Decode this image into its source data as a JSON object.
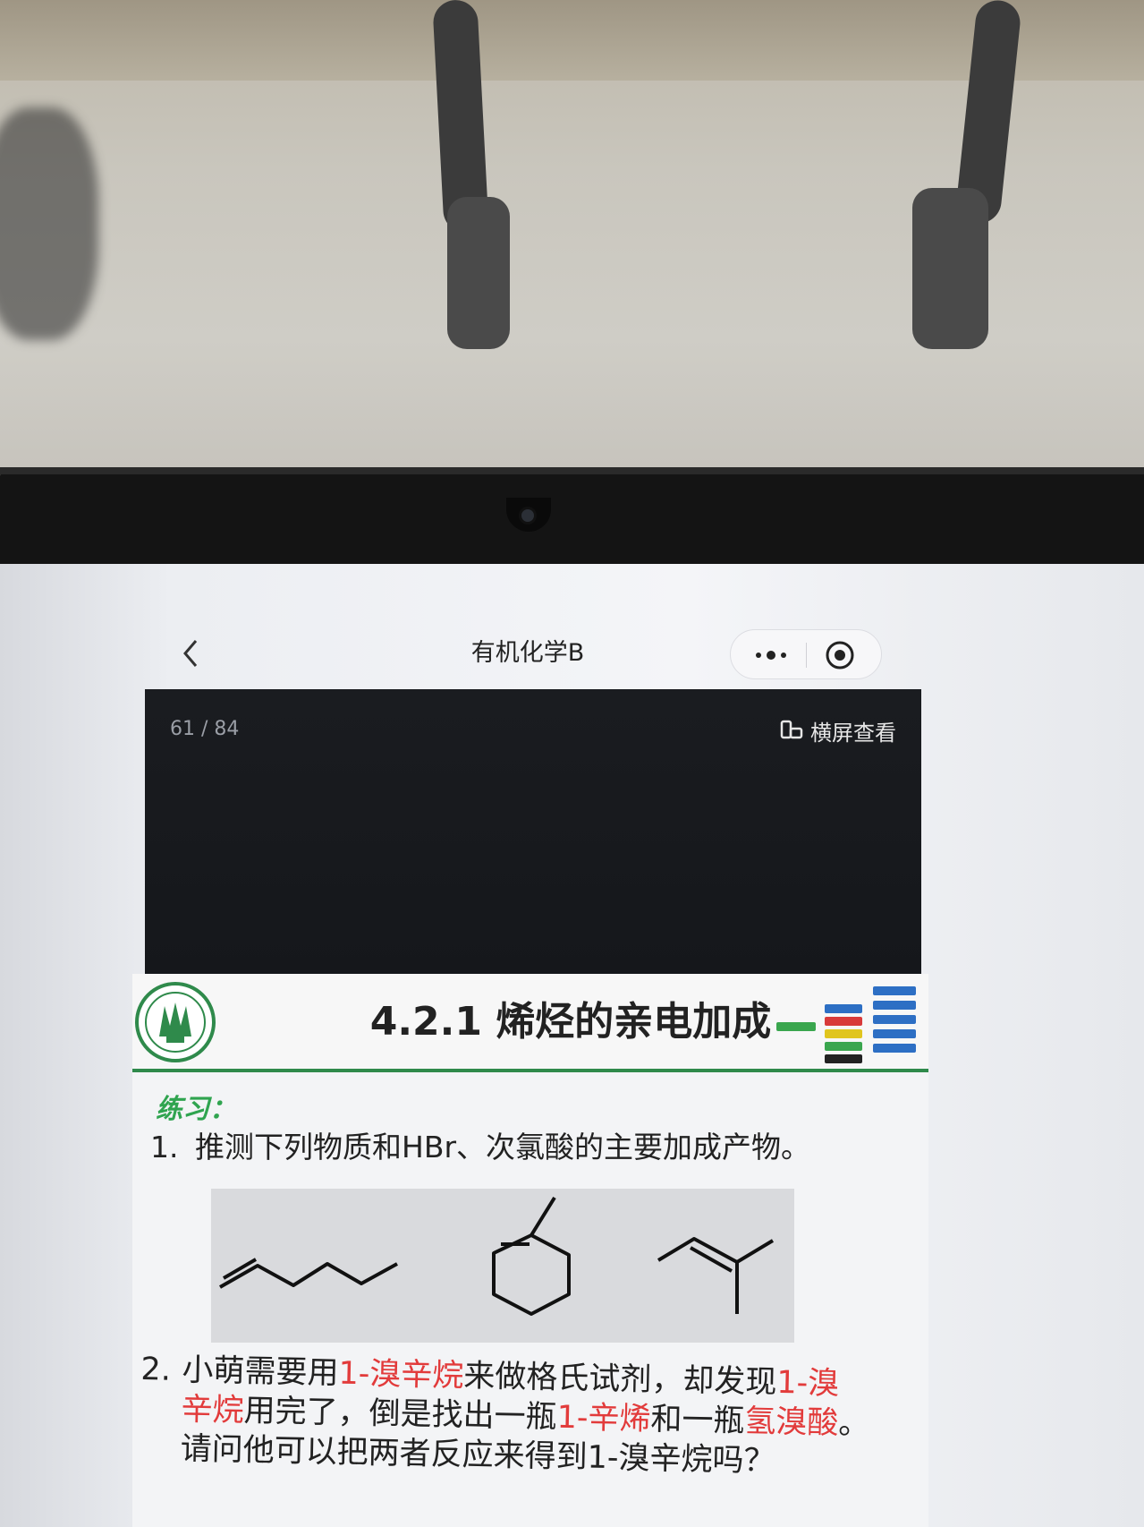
{
  "nav": {
    "title": "有机化学B"
  },
  "viewer": {
    "page_counter": "61 / 84",
    "landscape_label": "横屏查看"
  },
  "slide": {
    "title": "4.2.1 烯烃的亲电加成",
    "exercise_label": "练习：",
    "q1": {
      "num": "1.",
      "text": "推测下列物质和HBr、次氯酸的主要加成产物。"
    },
    "q2": {
      "num": "2.",
      "seg1": "小萌需要用",
      "seg2_red": "1-溴辛烷",
      "seg3": "来做格氏试剂，却发现",
      "seg4_red": "1-溴",
      "seg5_red": "辛烷",
      "seg6": "用完了，倒是找出一瓶",
      "seg7_red": "1-辛烯",
      "seg8": "和一瓶",
      "seg9_red": "氢溴酸",
      "seg10": "。",
      "seg11": "请问他可以把两者反应来得到1-溴辛烷吗？"
    }
  },
  "colors": {
    "accent_green": "#2fa44f",
    "header_rule": "#2f8a4b",
    "highlight_red": "#e23b3b"
  }
}
